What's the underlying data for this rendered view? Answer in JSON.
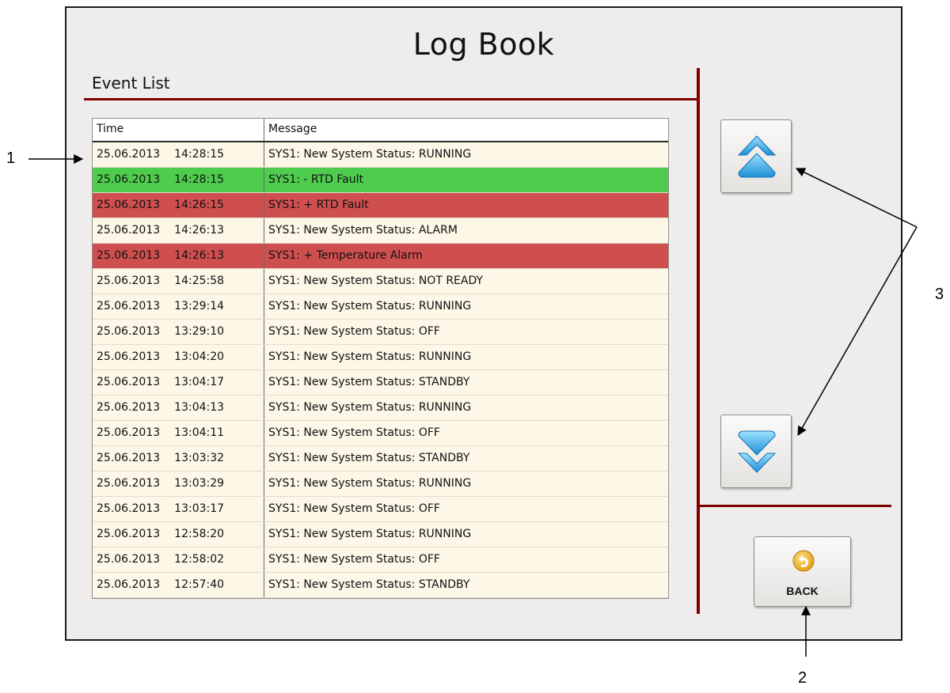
{
  "window": {
    "title": "Log Book"
  },
  "section": {
    "title": "Event List"
  },
  "table": {
    "headers": {
      "time": "Time",
      "message": "Message"
    },
    "rows": [
      {
        "date": "25.06.2013",
        "time": "14:28:15",
        "message": "SYS1: New System Status: RUNNING",
        "status": "normal"
      },
      {
        "date": "25.06.2013",
        "time": "14:28:15",
        "message": "SYS1: - RTD Fault",
        "status": "ok"
      },
      {
        "date": "25.06.2013",
        "time": "14:26:15",
        "message": "SYS1: + RTD Fault",
        "status": "fault"
      },
      {
        "date": "25.06.2013",
        "time": "14:26:13",
        "message": "SYS1: New System Status: ALARM",
        "status": "normal"
      },
      {
        "date": "25.06.2013",
        "time": "14:26:13",
        "message": "SYS1: + Temperature Alarm",
        "status": "fault"
      },
      {
        "date": "25.06.2013",
        "time": "14:25:58",
        "message": "SYS1: New System Status: NOT READY",
        "status": "normal"
      },
      {
        "date": "25.06.2013",
        "time": "13:29:14",
        "message": "SYS1: New System Status: RUNNING",
        "status": "normal"
      },
      {
        "date": "25.06.2013",
        "time": "13:29:10",
        "message": "SYS1: New System Status: OFF",
        "status": "normal"
      },
      {
        "date": "25.06.2013",
        "time": "13:04:20",
        "message": "SYS1: New System Status: RUNNING",
        "status": "normal"
      },
      {
        "date": "25.06.2013",
        "time": "13:04:17",
        "message": "SYS1: New System Status: STANDBY",
        "status": "normal"
      },
      {
        "date": "25.06.2013",
        "time": "13:04:13",
        "message": "SYS1: New System Status: RUNNING",
        "status": "normal"
      },
      {
        "date": "25.06.2013",
        "time": "13:04:11",
        "message": "SYS1: New System Status: OFF",
        "status": "normal"
      },
      {
        "date": "25.06.2013",
        "time": "13:03:32",
        "message": "SYS1: New System Status: STANDBY",
        "status": "normal"
      },
      {
        "date": "25.06.2013",
        "time": "13:03:29",
        "message": "SYS1: New System Status: RUNNING",
        "status": "normal"
      },
      {
        "date": "25.06.2013",
        "time": "13:03:17",
        "message": "SYS1: New System Status: OFF",
        "status": "normal"
      },
      {
        "date": "25.06.2013",
        "time": "12:58:20",
        "message": "SYS1: New System Status: RUNNING",
        "status": "normal"
      },
      {
        "date": "25.06.2013",
        "time": "12:58:02",
        "message": "SYS1: New System Status: OFF",
        "status": "normal"
      },
      {
        "date": "25.06.2013",
        "time": "12:57:40",
        "message": "SYS1: New System Status: STANDBY",
        "status": "normal"
      }
    ]
  },
  "buttons": {
    "scroll_up_icon": "double-chevron-up-icon",
    "scroll_down_icon": "double-chevron-down-icon",
    "back_label": "BACK",
    "back_icon": "return-arrow-icon"
  },
  "callouts": {
    "one": "1",
    "two": "2",
    "three": "3"
  },
  "colors": {
    "divider": "#800000",
    "row_ok": "#4ecc4e",
    "row_fault": "#cf4f4f",
    "row_normal": "#fdf7e7",
    "arrow_icon": "#35aee8"
  }
}
